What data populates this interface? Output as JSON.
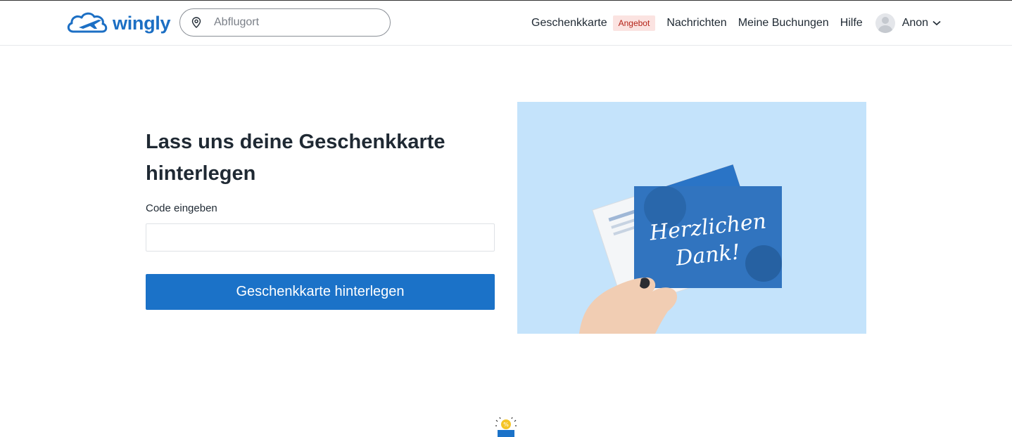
{
  "header": {
    "logo_text": "wingly",
    "search": {
      "placeholder": "Abflugort",
      "value": ""
    },
    "nav": {
      "giftcard": "Geschenkkarte",
      "offer_badge": "Angebot",
      "messages": "Nachrichten",
      "bookings": "Meine Buchungen",
      "help": "Hilfe",
      "user_name": "Anon"
    }
  },
  "main": {
    "title": "Lass uns deine Geschenkkarte hinterlegen",
    "code_label": "Code eingeben",
    "code_value": "",
    "submit_label": "Geschenkkarte hinterlegen"
  },
  "illustration": {
    "card_text_line1": "Herzlichen",
    "card_text_line2": "Dank!"
  },
  "colors": {
    "brand": "#1c6fc4",
    "button": "#1b72c8",
    "badge_bg": "#fbe3e1",
    "badge_text": "#b42318",
    "illustration_bg": "#c4e3fb"
  }
}
